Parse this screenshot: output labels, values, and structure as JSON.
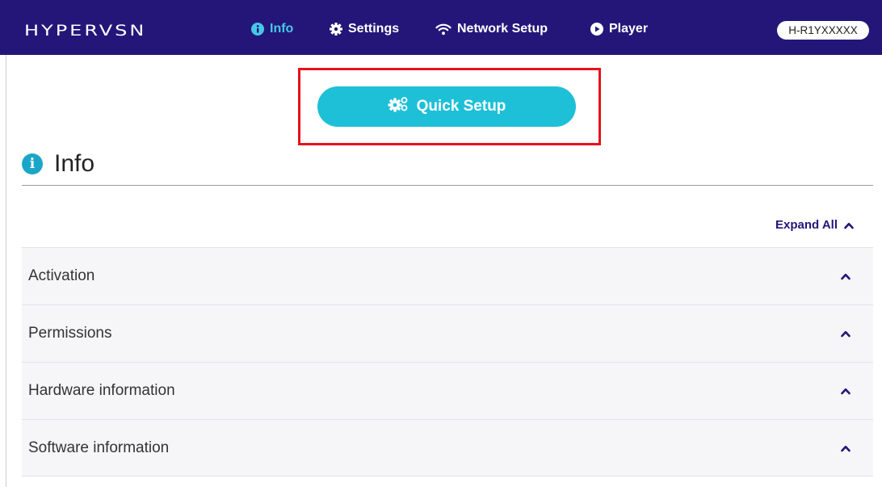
{
  "header": {
    "logo": "HYPERVSN",
    "nav": [
      {
        "label": "Info",
        "icon": "info-icon",
        "active": true
      },
      {
        "label": "Settings",
        "icon": "gear-icon",
        "active": false
      },
      {
        "label": "Network Setup",
        "icon": "wifi-icon",
        "active": false
      },
      {
        "label": "Player",
        "icon": "play-icon",
        "active": false
      }
    ],
    "device_id": "H-R1YXXXXX"
  },
  "quick_setup": {
    "label": "Quick Setup",
    "icon": "gears-icon",
    "highlight_color": "#e8121b"
  },
  "info_section": {
    "title": "Info",
    "icon": "info-icon",
    "expand_all_label": "Expand All",
    "panels": [
      {
        "label": "Activation",
        "expanded": true
      },
      {
        "label": "Permissions",
        "expanded": true
      },
      {
        "label": "Hardware information",
        "expanded": true
      },
      {
        "label": "Software information",
        "expanded": true
      }
    ]
  },
  "colors": {
    "nav_background": "#241679",
    "active_nav": "#45c8e6",
    "accent_button": "#1ec0d8",
    "panel_background": "#f6f6f9"
  }
}
